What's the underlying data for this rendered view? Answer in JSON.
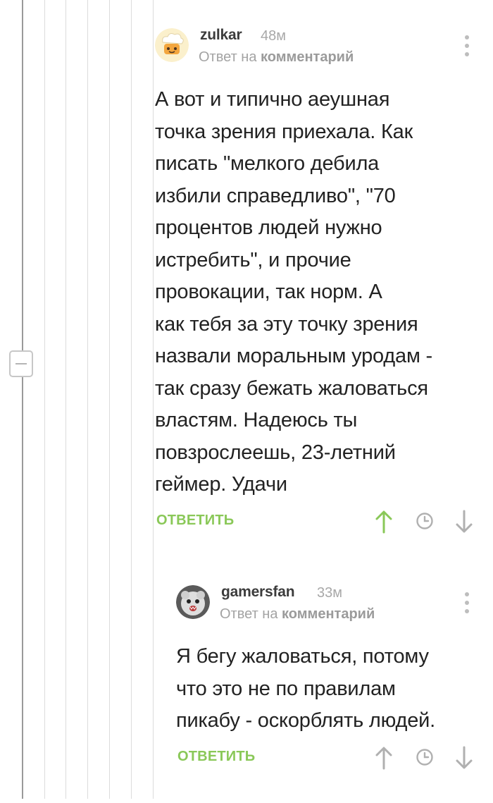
{
  "comments": [
    {
      "username": "zulkar",
      "time": "48м",
      "reply_prefix": "Ответ на",
      "reply_target": "комментарий",
      "text": "А вот и типично аеушная\nточка зрения приехала. Как\nписать \"мелкого дебила\nизбили справедливо\", \"70\nпроцентов людей нужно\nистребить\", и прочие\nпровокации, так норм. А\nкак тебя за эту точку зрения\nназвали моральным уродам -\nтак сразу бежать жаловаться\nвластям. Надеюсь ты\nповзрослеешь, 23-летний\nгеймер. Удачи",
      "reply_label": "ОТВЕТИТЬ",
      "upvoted": true
    },
    {
      "username": "gamersfan",
      "time": "33м",
      "reply_prefix": "Ответ на",
      "reply_target": "комментарий",
      "text": "Я бегу жаловаться, потому\nчто это не по правилам\nпикабу - оскорблять людей.",
      "reply_label": "ОТВЕТИТЬ",
      "upvoted": false
    }
  ],
  "colors": {
    "accent_green": "#8ac858",
    "icon_gray": "#b0b0b0",
    "thread_line": "#dcdcdc"
  },
  "icons": {
    "collapse": "minus-icon",
    "upvote": "arrow-up-icon",
    "save": "clock-icon",
    "downvote": "arrow-down-icon",
    "more": "more-vertical-icon"
  }
}
